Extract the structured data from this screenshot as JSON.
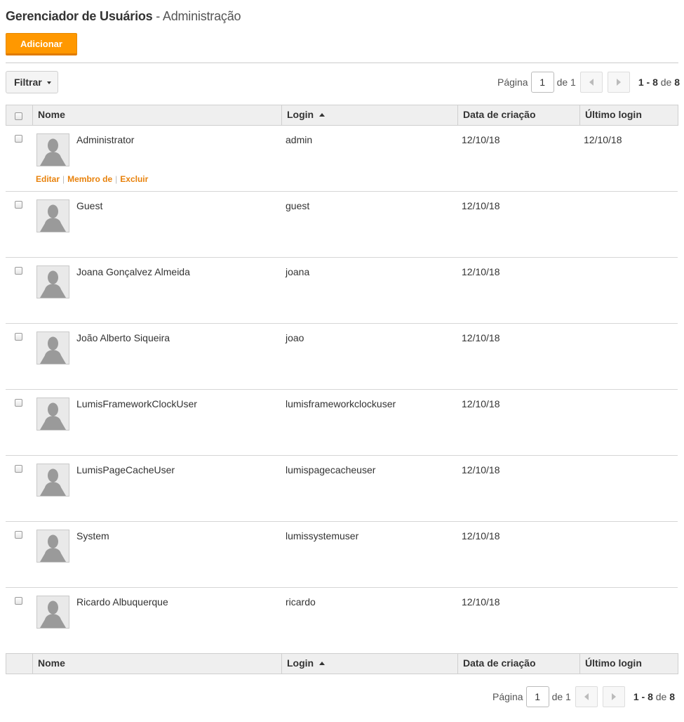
{
  "header": {
    "title": "Gerenciador de Usuários",
    "separator": " - ",
    "subtitle": "Administração"
  },
  "toolbar": {
    "add_label": "Adicionar",
    "filter_label": "Filtrar"
  },
  "pagination": {
    "page_label": "Página",
    "current_page": "1",
    "of_label": "de 1",
    "range": "1 - 8",
    "range_of": "de",
    "total": "8"
  },
  "table": {
    "columns": {
      "name": "Nome",
      "login": "Login",
      "created": "Data de criação",
      "last_login": "Último login"
    },
    "row_actions": {
      "edit": "Editar",
      "member_of": "Membro de",
      "delete": "Excluir"
    },
    "rows": [
      {
        "name": "Administrator",
        "login": "admin",
        "created": "12/10/18",
        "last_login": "12/10/18"
      },
      {
        "name": "Guest",
        "login": "guest",
        "created": "12/10/18",
        "last_login": ""
      },
      {
        "name": "Joana Gonçalvez Almeida",
        "login": "joana",
        "created": "12/10/18",
        "last_login": ""
      },
      {
        "name": "João Alberto Siqueira",
        "login": "joao",
        "created": "12/10/18",
        "last_login": ""
      },
      {
        "name": "LumisFrameworkClockUser",
        "login": "lumisframeworkclockuser",
        "created": "12/10/18",
        "last_login": ""
      },
      {
        "name": "LumisPageCacheUser",
        "login": "lumispagecacheuser",
        "created": "12/10/18",
        "last_login": ""
      },
      {
        "name": "System",
        "login": "lumissystemuser",
        "created": "12/10/18",
        "last_login": ""
      },
      {
        "name": "Ricardo Albuquerque",
        "login": "ricardo",
        "created": "12/10/18",
        "last_login": ""
      }
    ]
  },
  "colors": {
    "accent": "#ff9800",
    "link": "#e8820c",
    "header_bg": "#efefef"
  },
  "icons": {
    "avatar": "user-avatar-icon",
    "prev": "chevron-left-icon",
    "next": "chevron-right-icon",
    "sort": "sort-ascending-icon",
    "caret": "caret-down-icon"
  }
}
